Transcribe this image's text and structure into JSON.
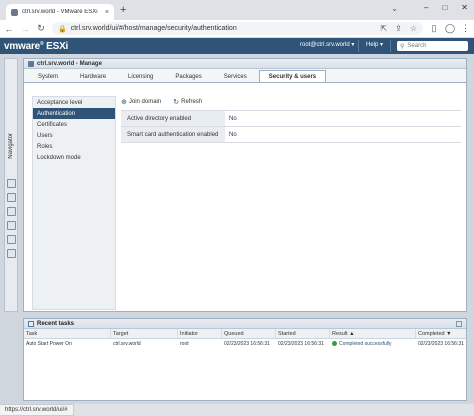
{
  "browser": {
    "tab_title": "ctrl.srv.world - VMware ESXi",
    "tab_close": "×",
    "new_tab": "+",
    "address": "ctrl.srv.world/ui/#/host/manage/security/authentication",
    "window_controls": [
      "–",
      "□",
      "✕"
    ]
  },
  "header": {
    "logo": "vmware",
    "product": "ESXi",
    "user": "root@ctrl.srv.world ▾",
    "help": "Help ▾",
    "search_placeholder": "Search"
  },
  "panel": {
    "title": "ctrl.srv.world - Manage",
    "tabs": [
      {
        "label": "System"
      },
      {
        "label": "Hardware"
      },
      {
        "label": "Licensing"
      },
      {
        "label": "Packages"
      },
      {
        "label": "Services"
      },
      {
        "label": "Security & users",
        "active": true
      }
    ]
  },
  "side_rail": {
    "navigator": "Navigator"
  },
  "sub_nav": [
    {
      "label": "Acceptance level"
    },
    {
      "label": "Authentication",
      "active": true
    },
    {
      "label": "Certificates"
    },
    {
      "label": "Users"
    },
    {
      "label": "Roles"
    },
    {
      "label": "Lockdown mode"
    }
  ],
  "toolbar": {
    "join_domain": "Join domain",
    "refresh": "Refresh"
  },
  "properties": [
    {
      "key": "Active directory enabled",
      "value": "No"
    },
    {
      "key": "Smart card authentication enabled",
      "value": "No"
    }
  ],
  "tasks": {
    "title": "Recent tasks",
    "columns": [
      "Task",
      "Target",
      "Initiator",
      "Queued",
      "Started",
      "Result ▲",
      "Completed ▼"
    ],
    "rows": [
      {
        "task": "Auto Start Power On",
        "target": "ctrl.srv.world",
        "initiator": "root",
        "queued": "02/23/2023 16:56:31",
        "started": "02/23/2023 16:56:31",
        "result": "Completed successfully",
        "completed": "02/23/2023 16:56:31"
      }
    ]
  },
  "status_url": "https://ctrl.srv.world/ui/#"
}
